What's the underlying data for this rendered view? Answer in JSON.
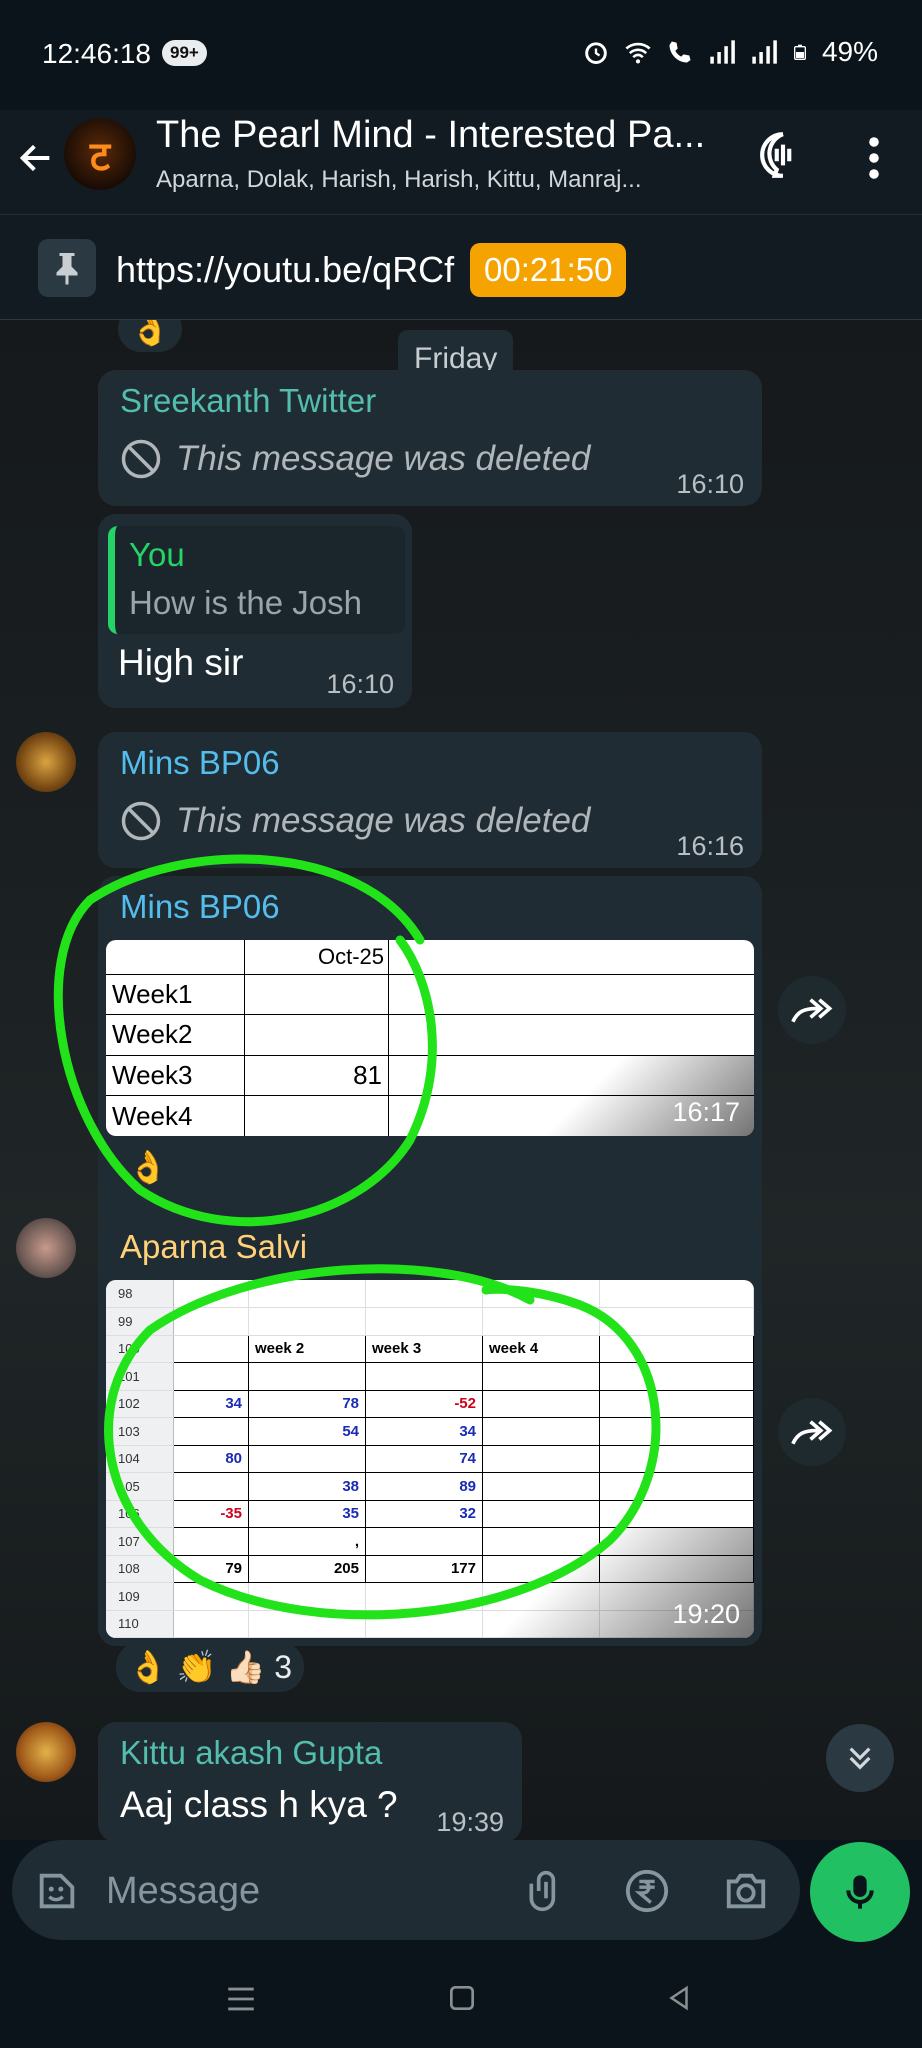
{
  "status": {
    "time": "12:46:18",
    "badge": "99+",
    "battery": "49%"
  },
  "header": {
    "title": "The Pearl Mind - Interested Pa...",
    "members": "Aparna, Dolak, Harish, Harish, Kittu, Manraj...",
    "avatar_glyph": "ट"
  },
  "pinned": {
    "text": "https://youtu.be/qRCf",
    "timer": "00:21:50"
  },
  "date_chip": "Friday",
  "messages": [
    {
      "sender": "Sreekanth Twitter",
      "sender_color": "#53bdae",
      "deleted_text": "This message was deleted",
      "time": "16:10"
    },
    {
      "quote_sender": "You",
      "quote_text": "How is the Josh",
      "text": "High sir",
      "time": "16:10"
    },
    {
      "sender": "Mins BP06",
      "sender_color": "#53bdeb",
      "deleted_text": "This message was deleted",
      "time": "16:16"
    },
    {
      "sender": "Mins BP06",
      "sender_color": "#53bdeb",
      "time": "16:17",
      "table": {
        "header": "Oct-25",
        "rows": [
          [
            "Week1",
            ""
          ],
          [
            "Week2",
            ""
          ],
          [
            "Week3",
            "81"
          ],
          [
            "Week4",
            ""
          ]
        ]
      },
      "reaction": "👌"
    },
    {
      "sender": "Aparna Salvi",
      "sender_color": "#ffd279",
      "time": "19:20",
      "sheet": {
        "row_numbers": [
          "98",
          "99",
          "100",
          "101",
          "102",
          "103",
          "104",
          "105",
          "106",
          "107",
          "108",
          "109",
          "110"
        ],
        "headers": [
          "week 2",
          "week 3",
          "week 4"
        ],
        "rows": [
          [
            "",
            "",
            "",
            ""
          ],
          [
            "",
            "",
            "",
            ""
          ],
          [
            "",
            "week 2",
            "week 3",
            "week 4"
          ],
          [
            "",
            "",
            "",
            ""
          ],
          [
            "34",
            "78",
            "-52",
            ""
          ],
          [
            "",
            "54",
            "34",
            ""
          ],
          [
            "80",
            "",
            "74",
            ""
          ],
          [
            "",
            "38",
            "89",
            ""
          ],
          [
            "-35",
            "35",
            "32",
            ""
          ],
          [
            "",
            ",",
            "",
            ""
          ],
          [
            "79",
            "205",
            "177",
            ""
          ],
          [
            "",
            "",
            "",
            ""
          ],
          [
            "",
            "",
            "",
            ""
          ]
        ]
      },
      "reactions": "👌 👏 👍🏻 3"
    },
    {
      "sender": "Kittu akash Gupta",
      "sender_color": "#53bdae",
      "text": "Aaj class h kya ?",
      "time": "19:39"
    }
  ],
  "composer": {
    "placeholder": "Message"
  },
  "top_reaction": "👌"
}
